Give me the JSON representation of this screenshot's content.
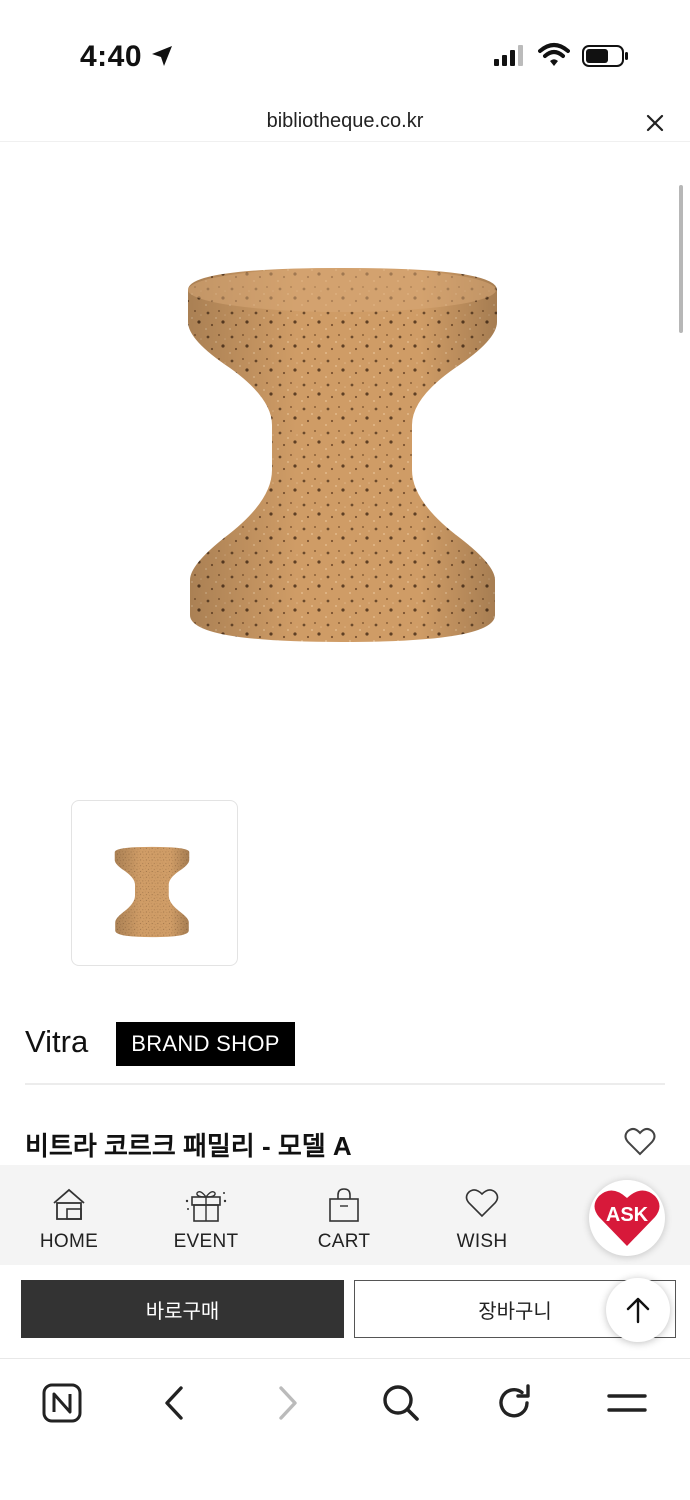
{
  "status_bar": {
    "time": "4:40"
  },
  "browser": {
    "url": "bibliotheque.co.kr"
  },
  "product": {
    "brand": "Vitra",
    "brand_shop_label": "BRAND SHOP",
    "name": "비트라 코르크 패밀리 - 모델 A"
  },
  "tab_menu": [
    {
      "label": "HOME",
      "icon": "home-icon"
    },
    {
      "label": "EVENT",
      "icon": "gift-icon"
    },
    {
      "label": "CART",
      "icon": "shopping-bag-icon"
    },
    {
      "label": "WISH",
      "icon": "heart-icon"
    }
  ],
  "ask": {
    "label": "ASK"
  },
  "actions": {
    "buy_now": "바로구매",
    "add_to_cart": "장바구니"
  },
  "colors": {
    "accent_red": "#d7193a",
    "cork": "#c9955e",
    "buy_button": "#333333"
  },
  "browser_toolbar": [
    "naver-icon",
    "back-icon",
    "forward-icon",
    "search-icon",
    "reload-icon",
    "menu-icon"
  ]
}
